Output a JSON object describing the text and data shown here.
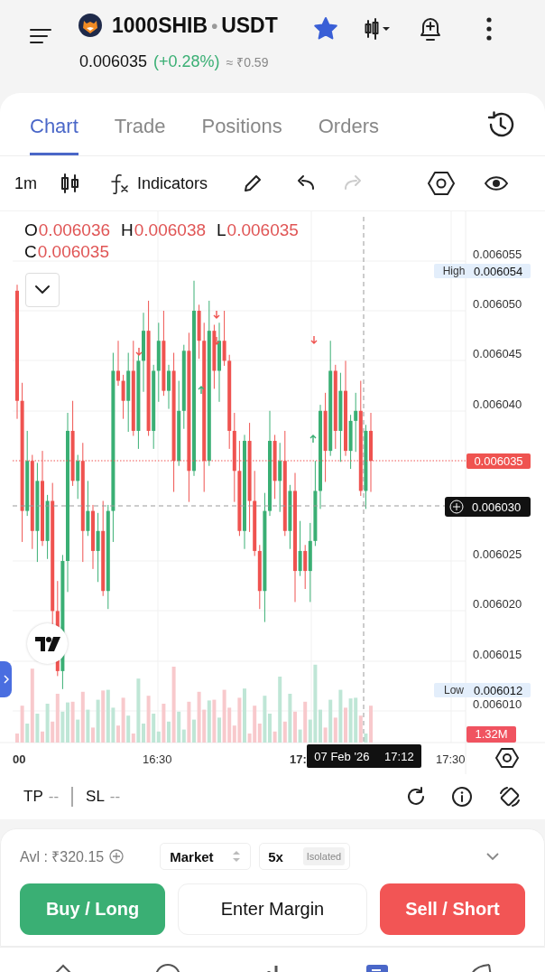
{
  "header": {
    "base": "1000SHIB",
    "separator": "•",
    "quote": "USDT",
    "price": "0.006035",
    "change": "(+0.28%)",
    "fiat": "≈ ₹0.59",
    "favorite": true
  },
  "tabs": [
    {
      "label": "Chart",
      "selected": true
    },
    {
      "label": "Trade",
      "selected": false
    },
    {
      "label": "Positions",
      "selected": false
    },
    {
      "label": "Orders",
      "selected": false
    }
  ],
  "toolbar": {
    "interval": "1m",
    "indicators": "Indicators",
    "undo_disabled": false,
    "redo_disabled": true
  },
  "ohlc": [
    {
      "key": "O",
      "value": "0.006036"
    },
    {
      "key": "H",
      "value": "0.006038"
    },
    {
      "key": "L",
      "value": "0.006035"
    },
    {
      "key": "C",
      "value": "0.006035"
    }
  ],
  "price_axis": [
    "0.006055",
    "0.006050",
    "0.006045",
    "0.006040",
    "0.006025",
    "0.006020",
    "0.006015",
    "0.006010"
  ],
  "high": {
    "label": "High",
    "value": "0.006054"
  },
  "low": {
    "label": "Low",
    "value": "0.006012"
  },
  "last_price": "0.006035",
  "crosshair_price": "0.006030",
  "volume": "1.32M",
  "time_axis": [
    "00",
    "16:30",
    "17:",
    "17:30"
  ],
  "crosshair_date": "07 Feb '26",
  "crosshair_time": "17:12",
  "tp": {
    "label": "TP",
    "value": "--"
  },
  "sl": {
    "label": "SL",
    "value": "--"
  },
  "order": {
    "available": "Avl : ₹320.15",
    "order_type": "Market",
    "leverage": "5x",
    "margin_mode": "Isolated",
    "buttons": [
      {
        "label": "Buy / Long",
        "kind": "buy"
      },
      {
        "label": "Enter Margin",
        "kind": "margin"
      },
      {
        "label": "Sell / Short",
        "kind": "sell"
      }
    ]
  },
  "bottom_nav": [
    {
      "selected": false
    },
    {
      "selected": false
    },
    {
      "selected": false
    },
    {
      "selected": true
    },
    {
      "selected": false
    }
  ]
}
